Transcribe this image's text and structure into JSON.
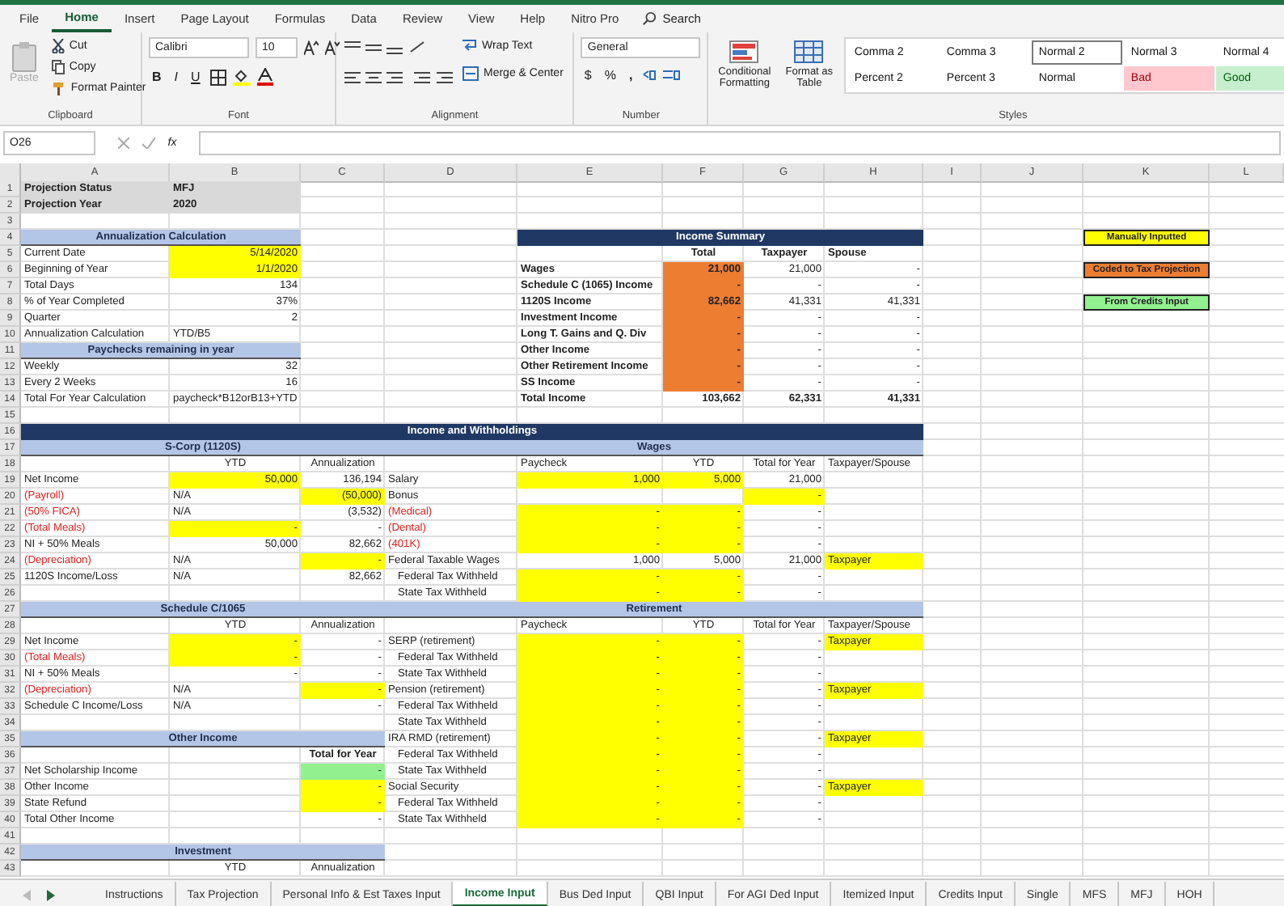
{
  "ribbon": {
    "tabs": [
      {
        "label": "File",
        "selected": false
      },
      {
        "label": "Home",
        "selected": true
      },
      {
        "label": "Insert",
        "selected": false
      },
      {
        "label": "Page Layout",
        "selected": false
      },
      {
        "label": "Formulas",
        "selected": false
      },
      {
        "label": "Data",
        "selected": false
      },
      {
        "label": "Review",
        "selected": false
      },
      {
        "label": "View",
        "selected": false
      },
      {
        "label": "Help",
        "selected": false
      },
      {
        "label": "Nitro Pro",
        "selected": false
      }
    ],
    "search": "Search",
    "clipboard": {
      "paste": "Paste",
      "paste_disabled": true,
      "cut": "Cut",
      "copy": "Copy",
      "format_painter": "Format Painter",
      "label": "Clipboard"
    },
    "font": {
      "name": "Calibri",
      "size": "10",
      "bold": "B",
      "italic": "I",
      "underline": "U",
      "label": "Font"
    },
    "alignment": {
      "wrap": "Wrap Text",
      "merge": "Merge & Center",
      "label": "Alignment"
    },
    "number": {
      "format": "General",
      "currency": "$",
      "percent": "%",
      "comma": ",",
      "label": "Number"
    },
    "styles": {
      "conditional": "Conditional Formatting",
      "format_table": "Format as Table",
      "label": "Styles",
      "cells": [
        {
          "label": "Comma 2",
          "kind": "plain",
          "selected": false
        },
        {
          "label": "Comma 3",
          "kind": "plain",
          "selected": false
        },
        {
          "label": "Normal 2",
          "kind": "plain",
          "selected": true
        },
        {
          "label": "Normal 3",
          "kind": "plain",
          "selected": false
        },
        {
          "label": "Normal 4",
          "kind": "plain",
          "selected": false
        },
        {
          "label": "Percent 2",
          "kind": "plain",
          "selected": false
        },
        {
          "label": "Percent 3",
          "kind": "plain",
          "selected": false
        },
        {
          "label": "Normal",
          "kind": "plain",
          "selected": false
        },
        {
          "label": "Bad",
          "kind": "bad",
          "selected": false
        },
        {
          "label": "Good",
          "kind": "good",
          "selected": false
        }
      ]
    }
  },
  "formula_bar": {
    "name_box": "O26",
    "fx": "fx"
  },
  "columns": [
    "A",
    "B",
    "C",
    "D",
    "E",
    "F",
    "G",
    "H",
    "I",
    "J",
    "K",
    "L"
  ],
  "rows": [
    {
      "row": "1",
      "cells": [
        {
          "text": "Projection Status",
          "kind": "bold",
          "color": "#d9d9d9"
        },
        {
          "text": "MFJ",
          "kind": "bold",
          "color": "#d9d9d9"
        }
      ]
    },
    {
      "row": "2",
      "cells": [
        {
          "text": "Projection Year",
          "kind": "bold",
          "color": "#d9d9d9"
        },
        {
          "text": "2020",
          "kind": "bold",
          "color": "#d9d9d9"
        }
      ]
    },
    {
      "row": "3"
    },
    {
      "row": "4",
      "cells": [
        {
          "text": "Annualization Calculation",
          "kind": "band"
        },
        null,
        {},
        {},
        {
          "text": "Income Summary",
          "kind": "title"
        },
        null,
        null,
        null,
        {},
        {},
        {
          "text": "Manually Inputted",
          "kind": "legend",
          "color": "#ffff00"
        }
      ]
    },
    {
      "row": "5",
      "cells": [
        {
          "text": "Current Date",
          "kind": "label"
        },
        {
          "text": "5/14/2020",
          "kind": "num",
          "color": "#ffff00"
        },
        null,
        null,
        null,
        {
          "text": "Total",
          "kind": "bold-center"
        },
        {
          "text": "Taxpayer",
          "kind": "bold-center"
        },
        {
          "text": "Spouse",
          "kind": "bold"
        }
      ]
    },
    {
      "row": "6",
      "cells": [
        {
          "text": "Beginning of Year",
          "kind": "label"
        },
        {
          "text": "1/1/2020",
          "kind": "num",
          "color": "#ffff00"
        },
        null,
        null,
        {
          "text": "Wages",
          "kind": "bold"
        },
        {
          "text": "21,000",
          "kind": "bold-num",
          "color": "#ed7d31"
        },
        {
          "text": "21,000",
          "kind": "num"
        },
        {
          "text": "-",
          "kind": "num"
        },
        null,
        null,
        {
          "text": "Coded to Tax Projection",
          "kind": "legend",
          "color": "#ed7d31"
        }
      ]
    },
    {
      "row": "7",
      "cells": [
        {
          "text": "Total Days",
          "kind": "label"
        },
        {
          "text": "134",
          "kind": "num"
        },
        null,
        null,
        {
          "text": "Schedule C (1065) Income",
          "kind": "bold"
        },
        {
          "text": "-",
          "kind": "bold-num",
          "color": "#ed7d31"
        },
        {
          "text": "-",
          "kind": "num"
        },
        {
          "text": "-",
          "kind": "num"
        }
      ]
    },
    {
      "row": "8",
      "cells": [
        {
          "text": "% of Year Completed",
          "kind": "label"
        },
        {
          "text": "37%",
          "kind": "num"
        },
        null,
        null,
        {
          "text": "1120S Income",
          "kind": "bold"
        },
        {
          "text": "82,662",
          "kind": "bold-num",
          "color": "#ed7d31"
        },
        {
          "text": "41,331",
          "kind": "num"
        },
        {
          "text": "41,331",
          "kind": "num"
        },
        null,
        null,
        {
          "text": "From Credits Input",
          "kind": "legend",
          "color": "#92f08f"
        }
      ]
    },
    {
      "row": "9",
      "cells": [
        {
          "text": "Quarter",
          "kind": "label"
        },
        {
          "text": "2",
          "kind": "num"
        },
        null,
        null,
        {
          "text": "Investment Income",
          "kind": "bold"
        },
        {
          "text": "-",
          "kind": "bold-num",
          "color": "#ed7d31"
        },
        {
          "text": "-",
          "kind": "num"
        },
        {
          "text": "-",
          "kind": "num"
        }
      ]
    },
    {
      "row": "10",
      "cells": [
        {
          "text": "Annualization Calculation",
          "kind": "label"
        },
        {
          "text": "YTD/B5",
          "kind": "label"
        },
        null,
        null,
        {
          "text": "Long T. Gains and Q. Div",
          "kind": "bold"
        },
        {
          "text": "-",
          "kind": "bold-num",
          "color": "#ed7d31"
        },
        {
          "text": "-",
          "kind": "num"
        },
        {
          "text": "-",
          "kind": "num"
        }
      ]
    },
    {
      "row": "11",
      "cells": [
        {
          "text": "Paychecks remaining in year",
          "kind": "band"
        },
        null,
        {},
        {},
        {
          "text": "Other Income",
          "kind": "bold"
        },
        {
          "text": "-",
          "kind": "bold-num",
          "color": "#ed7d31"
        },
        {
          "text": "-",
          "kind": "num"
        },
        {
          "text": "-",
          "kind": "num"
        }
      ]
    },
    {
      "row": "12",
      "cells": [
        {
          "text": "Weekly",
          "kind": "label"
        },
        {
          "text": "32",
          "kind": "num"
        },
        null,
        null,
        {
          "text": "Other Retirement Income",
          "kind": "bold"
        },
        {
          "text": "-",
          "kind": "bold-num",
          "color": "#ed7d31"
        },
        {
          "text": "-",
          "kind": "num"
        },
        {
          "text": "-",
          "kind": "num"
        }
      ]
    },
    {
      "row": "13",
      "cells": [
        {
          "text": "Every 2 Weeks",
          "kind": "label"
        },
        {
          "text": "16",
          "kind": "num"
        },
        null,
        null,
        {
          "text": "SS Income",
          "kind": "bold"
        },
        {
          "text": "-",
          "kind": "bold-num",
          "color": "#ed7d31"
        },
        {
          "text": "-",
          "kind": "num"
        },
        {
          "text": "-",
          "kind": "num"
        }
      ]
    },
    {
      "row": "14",
      "cells": [
        {
          "text": "Total For Year Calculation",
          "kind": "label"
        },
        {
          "text": "paycheck*B12orB13+YTD",
          "kind": "label"
        },
        null,
        null,
        {
          "text": "Total Income",
          "kind": "bold"
        },
        {
          "text": "103,662",
          "kind": "bold-num"
        },
        {
          "text": "62,331",
          "kind": "bold-num"
        },
        {
          "text": "41,331",
          "kind": "bold-num"
        }
      ]
    },
    {
      "row": "15"
    },
    {
      "row": "16",
      "cells": [
        {
          "text": "Income and Withholdings",
          "kind": "title"
        },
        null,
        null,
        null,
        null,
        null,
        null,
        null
      ]
    },
    {
      "row": "17",
      "cells": [
        {
          "text": "S-Corp (1120S)",
          "kind": "band"
        },
        null,
        null,
        {
          "text": "Wages",
          "kind": "band"
        },
        null,
        null,
        null,
        null
      ]
    },
    {
      "row": "18",
      "cells": [
        null,
        {
          "text": "YTD",
          "kind": "center"
        },
        {
          "text": "Annualization",
          "kind": "center"
        },
        null,
        {
          "text": "Paycheck",
          "kind": "label"
        },
        {
          "text": "YTD",
          "kind": "center"
        },
        {
          "text": "Total for Year",
          "kind": "center"
        },
        {
          "text": "Taxpayer/Spouse",
          "kind": "label"
        }
      ]
    },
    {
      "row": "19",
      "cells": [
        {
          "text": "Net Income",
          "kind": "label"
        },
        {
          "text": "50,000",
          "kind": "num",
          "color": "#ffff00"
        },
        {
          "text": "136,194",
          "kind": "num"
        },
        {
          "text": "Salary",
          "kind": "label"
        },
        {
          "text": "1,000",
          "kind": "num",
          "color": "#ffff00"
        },
        {
          "text": "5,000",
          "kind": "num",
          "color": "#ffff00"
        },
        {
          "text": "21,000",
          "kind": "num"
        }
      ]
    },
    {
      "row": "20",
      "cells": [
        {
          "text": "(Payroll)",
          "kind": "neg"
        },
        {
          "text": "N/A",
          "kind": "label"
        },
        {
          "text": "(50,000)",
          "kind": "num",
          "color": "#ffff00"
        },
        {
          "text": "Bonus",
          "kind": "label"
        },
        null,
        null,
        {
          "text": "-",
          "kind": "num",
          "color": "#ffff00"
        }
      ]
    },
    {
      "row": "21",
      "cells": [
        {
          "text": "(50% FICA)",
          "kind": "neg"
        },
        {
          "text": "N/A",
          "kind": "label"
        },
        {
          "text": "(3,532)",
          "kind": "num"
        },
        {
          "text": "(Medical)",
          "kind": "neg"
        },
        {
          "text": "-",
          "kind": "num",
          "color": "#ffff00"
        },
        {
          "text": "-",
          "kind": "num",
          "color": "#ffff00"
        },
        {
          "text": "-",
          "kind": "num"
        }
      ]
    },
    {
      "row": "22",
      "cells": [
        {
          "text": "(Total Meals)",
          "kind": "neg"
        },
        {
          "text": "-",
          "kind": "num",
          "color": "#ffff00"
        },
        {
          "text": "-",
          "kind": "num"
        },
        {
          "text": "(Dental)",
          "kind": "neg"
        },
        {
          "text": "-",
          "kind": "num",
          "color": "#ffff00"
        },
        {
          "text": "-",
          "kind": "num",
          "color": "#ffff00"
        },
        {
          "text": "-",
          "kind": "num"
        }
      ]
    },
    {
      "row": "23",
      "cells": [
        {
          "text": "NI + 50% Meals",
          "kind": "label"
        },
        {
          "text": "50,000",
          "kind": "num"
        },
        {
          "text": "82,662",
          "kind": "num"
        },
        {
          "text": "(401K)",
          "kind": "neg"
        },
        {
          "text": "-",
          "kind": "num",
          "color": "#ffff00"
        },
        {
          "text": "-",
          "kind": "num",
          "color": "#ffff00"
        },
        {
          "text": "-",
          "kind": "num"
        }
      ]
    },
    {
      "row": "24",
      "cells": [
        {
          "text": "(Depreciation)",
          "kind": "neg"
        },
        {
          "text": "N/A",
          "kind": "label"
        },
        {
          "text": "-",
          "kind": "num",
          "color": "#ffff00"
        },
        {
          "text": "Federal Taxable Wages",
          "kind": "label"
        },
        {
          "text": "1,000",
          "kind": "num"
        },
        {
          "text": "5,000",
          "kind": "num"
        },
        {
          "text": "21,000",
          "kind": "num"
        },
        {
          "text": "Taxpayer",
          "kind": "label",
          "color": "#ffff00"
        }
      ]
    },
    {
      "row": "25",
      "cells": [
        {
          "text": "1120S Income/Loss",
          "kind": "label"
        },
        {
          "text": "N/A",
          "kind": "label"
        },
        {
          "text": "82,662",
          "kind": "num"
        },
        {
          "text": "Federal Tax Withheld",
          "kind": "sub"
        },
        {
          "text": "-",
          "kind": "num",
          "color": "#ffff00"
        },
        {
          "text": "-",
          "kind": "num",
          "color": "#ffff00"
        },
        {
          "text": "-",
          "kind": "num"
        }
      ]
    },
    {
      "row": "26",
      "cells": [
        null,
        null,
        null,
        {
          "text": "State Tax Withheld",
          "kind": "sub"
        },
        {
          "text": "-",
          "kind": "num",
          "color": "#ffff00"
        },
        {
          "text": "-",
          "kind": "num",
          "color": "#ffff00"
        },
        {
          "text": "-",
          "kind": "num"
        }
      ]
    },
    {
      "row": "27",
      "cells": [
        {
          "text": "Schedule C/1065",
          "kind": "band"
        },
        null,
        null,
        {
          "text": "Retirement",
          "kind": "band"
        },
        null,
        null,
        null,
        null
      ]
    },
    {
      "row": "28",
      "cells": [
        null,
        {
          "text": "YTD",
          "kind": "center"
        },
        {
          "text": "Annualization",
          "kind": "center"
        },
        null,
        {
          "text": "Paycheck",
          "kind": "label"
        },
        {
          "text": "YTD",
          "kind": "center"
        },
        {
          "text": "Total for Year",
          "kind": "center"
        },
        {
          "text": "Taxpayer/Spouse",
          "kind": "label"
        }
      ]
    },
    {
      "row": "29",
      "cells": [
        {
          "text": "Net Income",
          "kind": "label"
        },
        {
          "text": "-",
          "kind": "num",
          "color": "#ffff00"
        },
        {
          "text": "-",
          "kind": "num"
        },
        {
          "text": "SERP (retirement)",
          "kind": "label"
        },
        {
          "text": "-",
          "kind": "num",
          "color": "#ffff00"
        },
        {
          "text": "-",
          "kind": "num",
          "color": "#ffff00"
        },
        {
          "text": "-",
          "kind": "num"
        },
        {
          "text": "Taxpayer",
          "kind": "label",
          "color": "#ffff00"
        }
      ]
    },
    {
      "row": "30",
      "cells": [
        {
          "text": "(Total Meals)",
          "kind": "neg"
        },
        {
          "text": "-",
          "kind": "num",
          "color": "#ffff00"
        },
        {
          "text": "-",
          "kind": "num"
        },
        {
          "text": "Federal Tax Withheld",
          "kind": "sub"
        },
        {
          "text": "-",
          "kind": "num",
          "color": "#ffff00"
        },
        {
          "text": "-",
          "kind": "num",
          "color": "#ffff00"
        },
        {
          "text": "-",
          "kind": "num"
        }
      ]
    },
    {
      "row": "31",
      "cells": [
        {
          "text": "NI + 50% Meals",
          "kind": "label"
        },
        {
          "text": "-",
          "kind": "num"
        },
        {
          "text": "-",
          "kind": "num"
        },
        {
          "text": "State Tax Withheld",
          "kind": "sub"
        },
        {
          "text": "-",
          "kind": "num",
          "color": "#ffff00"
        },
        {
          "text": "-",
          "kind": "num",
          "color": "#ffff00"
        },
        {
          "text": "-",
          "kind": "num"
        }
      ]
    },
    {
      "row": "32",
      "cells": [
        {
          "text": "(Depreciation)",
          "kind": "neg"
        },
        {
          "text": "N/A",
          "kind": "label"
        },
        {
          "text": "-",
          "kind": "num",
          "color": "#ffff00"
        },
        {
          "text": "Pension (retirement)",
          "kind": "label"
        },
        {
          "text": "-",
          "kind": "num",
          "color": "#ffff00"
        },
        {
          "text": "-",
          "kind": "num",
          "color": "#ffff00"
        },
        {
          "text": "-",
          "kind": "num"
        },
        {
          "text": "Taxpayer",
          "kind": "label",
          "color": "#ffff00"
        }
      ]
    },
    {
      "row": "33",
      "cells": [
        {
          "text": "Schedule C Income/Loss",
          "kind": "label"
        },
        {
          "text": "N/A",
          "kind": "label"
        },
        {
          "text": "-",
          "kind": "num"
        },
        {
          "text": "Federal Tax Withheld",
          "kind": "sub"
        },
        {
          "text": "-",
          "kind": "num",
          "color": "#ffff00"
        },
        {
          "text": "-",
          "kind": "num",
          "color": "#ffff00"
        },
        {
          "text": "-",
          "kind": "num"
        }
      ]
    },
    {
      "row": "34",
      "cells": [
        null,
        null,
        null,
        {
          "text": "State Tax Withheld",
          "kind": "sub"
        },
        {
          "text": "-",
          "kind": "num",
          "color": "#ffff00"
        },
        {
          "text": "-",
          "kind": "num",
          "color": "#ffff00"
        },
        {
          "text": "-",
          "kind": "num"
        }
      ]
    },
    {
      "row": "35",
      "cells": [
        {
          "text": "Other Income",
          "kind": "band"
        },
        null,
        null,
        {
          "text": "IRA RMD (retirement)",
          "kind": "label"
        },
        {
          "text": "-",
          "kind": "num",
          "color": "#ffff00"
        },
        {
          "text": "-",
          "kind": "num",
          "color": "#ffff00"
        },
        {
          "text": "-",
          "kind": "num"
        },
        {
          "text": "Taxpayer",
          "kind": "label",
          "color": "#ffff00"
        }
      ]
    },
    {
      "row": "36",
      "cells": [
        null,
        null,
        {
          "text": "Total for Year",
          "kind": "bold-center"
        },
        {
          "text": "Federal Tax Withheld",
          "kind": "sub"
        },
        {
          "text": "-",
          "kind": "num",
          "color": "#ffff00"
        },
        {
          "text": "-",
          "kind": "num",
          "color": "#ffff00"
        },
        {
          "text": "-",
          "kind": "num"
        }
      ]
    },
    {
      "row": "37",
      "cells": [
        {
          "text": "Net Scholarship Income",
          "kind": "label"
        },
        null,
        {
          "text": "-",
          "kind": "num",
          "color": "#92f08f"
        },
        {
          "text": "State Tax Withheld",
          "kind": "sub"
        },
        {
          "text": "-",
          "kind": "num",
          "color": "#ffff00"
        },
        {
          "text": "-",
          "kind": "num",
          "color": "#ffff00"
        },
        {
          "text": "-",
          "kind": "num"
        }
      ]
    },
    {
      "row": "38",
      "cells": [
        {
          "text": "Other Income",
          "kind": "label"
        },
        null,
        {
          "text": "-",
          "kind": "num",
          "color": "#ffff00"
        },
        {
          "text": "Social Security",
          "kind": "label"
        },
        {
          "text": "-",
          "kind": "num",
          "color": "#ffff00"
        },
        {
          "text": "-",
          "kind": "num",
          "color": "#ffff00"
        },
        {
          "text": "-",
          "kind": "num"
        },
        {
          "text": "Taxpayer",
          "kind": "label",
          "color": "#ffff00"
        }
      ]
    },
    {
      "row": "39",
      "cells": [
        {
          "text": "State Refund",
          "kind": "label"
        },
        null,
        {
          "text": "-",
          "kind": "num",
          "color": "#ffff00"
        },
        {
          "text": "Federal Tax Withheld",
          "kind": "sub"
        },
        {
          "text": "-",
          "kind": "num",
          "color": "#ffff00"
        },
        {
          "text": "-",
          "kind": "num",
          "color": "#ffff00"
        },
        {
          "text": "-",
          "kind": "num"
        }
      ]
    },
    {
      "row": "40",
      "cells": [
        {
          "text": "Total Other Income",
          "kind": "label"
        },
        null,
        {
          "text": "-",
          "kind": "num"
        },
        {
          "text": "State Tax Withheld",
          "kind": "sub"
        },
        {
          "text": "-",
          "kind": "num",
          "color": "#ffff00"
        },
        {
          "text": "-",
          "kind": "num",
          "color": "#ffff00"
        },
        {
          "text": "-",
          "kind": "num"
        }
      ]
    },
    {
      "row": "41"
    },
    {
      "row": "42",
      "cells": [
        {
          "text": "Investment",
          "kind": "band"
        },
        null,
        null
      ]
    },
    {
      "row": "43",
      "cells": [
        null,
        {
          "text": "YTD",
          "kind": "center"
        },
        {
          "text": "Annualization",
          "kind": "center"
        }
      ]
    }
  ],
  "sheet_tabs": [
    {
      "label": "Instructions",
      "selected": false
    },
    {
      "label": "Tax Projection",
      "selected": false
    },
    {
      "label": "Personal Info & Est Taxes Input",
      "selected": false
    },
    {
      "label": "Income Input",
      "selected": true
    },
    {
      "label": "Bus Ded Input",
      "selected": false
    },
    {
      "label": "QBI Input",
      "selected": false
    },
    {
      "label": "For AGI Ded Input",
      "selected": false
    },
    {
      "label": "Itemized Input",
      "selected": false
    },
    {
      "label": "Credits Input",
      "selected": false
    },
    {
      "label": "Single",
      "selected": false
    },
    {
      "label": "MFS",
      "selected": false
    },
    {
      "label": "MFJ",
      "selected": false
    },
    {
      "label": "HOH",
      "selected": false
    }
  ]
}
